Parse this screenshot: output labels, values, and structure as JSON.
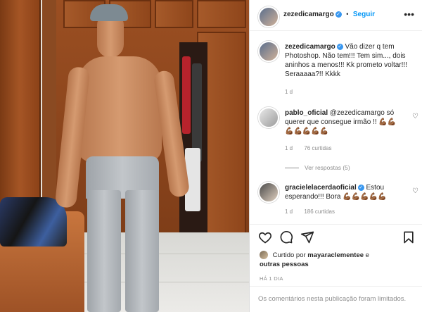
{
  "post": {
    "author": "zezedicamargo",
    "follow_label": "Seguir",
    "separator": "•",
    "more_icon": "more-horizontal-icon",
    "caption": "Vão dizer q tem Photoshop. Não tem!!! Tem sim..., dois aninhos a menos!!! Kk prometo voltar!!! Seraaaaa?!! Kkkk",
    "caption_age": "1 d"
  },
  "comments": [
    {
      "author": "pablo_oficial",
      "text": "@zezedicamargo só querer que consegue irmão !! 💪🏾💪🏾",
      "extra": "💪🏾💪🏾💪🏾💪🏾💪🏾",
      "age": "1 d",
      "likes": "76 curtidas",
      "replies": "Ver respostas (5)"
    },
    {
      "author": "gracielelacerdaoficial",
      "text": "Estou esperando!!! Bora 💪🏾💪🏾💪🏾💪🏾💪🏾",
      "age": "1 d",
      "likes": "186 curtidas"
    }
  ],
  "actions": {
    "icons": [
      "heart-icon",
      "comment-icon",
      "share-icon",
      "bookmark-icon"
    ]
  },
  "liked_by": {
    "prefix": "Curtido por",
    "user": "mayaraclementee",
    "suffix": "e",
    "others": "outras pessoas"
  },
  "date": "HÁ 1 DIA",
  "comments_limited": "Os comentários nesta publicação foram limitados."
}
